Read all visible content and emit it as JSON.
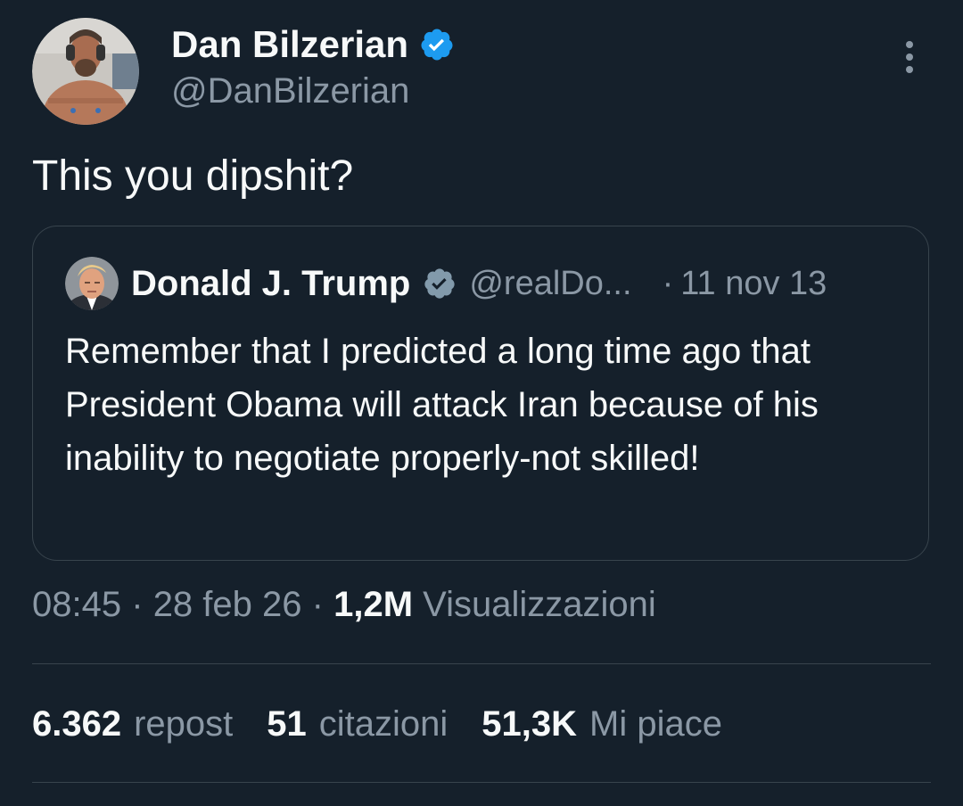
{
  "author": {
    "display_name": "Dan Bilzerian",
    "handle": "@DanBilzerian",
    "verified_icon": "verified-badge-icon",
    "verified_color": "#1d9bf0"
  },
  "tweet": {
    "text": "This you dipshit?"
  },
  "quoted_tweet": {
    "display_name": "Donald J. Trump",
    "handle": "@realDo...",
    "separator": "·",
    "date": "11 nov 13",
    "verified_icon": "verified-badge-icon",
    "verified_color": "#829aab",
    "text": "Remember that I predicted a long time ago that President Obama will attack Iran because of his inability to negotiate properly-not skilled!"
  },
  "meta": {
    "time": "08:45",
    "sep1": "·",
    "date": "28 feb 26",
    "sep2": "·",
    "views_count": "1,2M",
    "views_label": "Visualizzazioni"
  },
  "stats": {
    "reposts_count": "6.362",
    "reposts_label": "repost",
    "quotes_count": "51",
    "quotes_label": "citazioni",
    "likes_count": "51,3K",
    "likes_label": "Mi piace"
  },
  "colors": {
    "background": "#15202b",
    "text_primary": "#f7f9f9",
    "text_secondary": "#8b98a5",
    "border": "#38444d"
  }
}
